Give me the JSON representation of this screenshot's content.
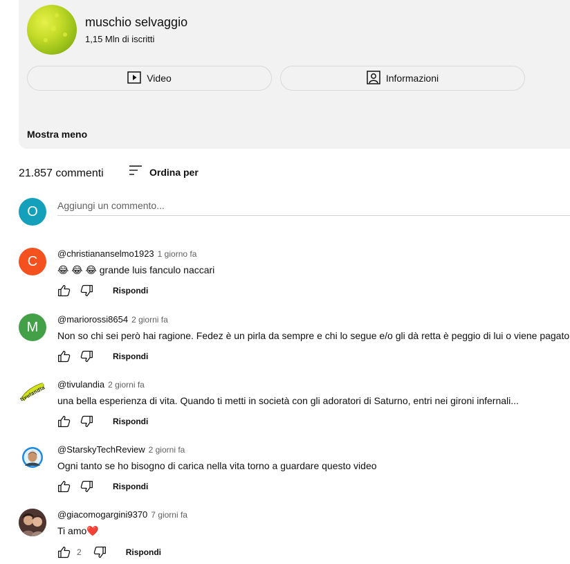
{
  "channel": {
    "name": "muschio selvaggio",
    "subscribers": "1,15 Mln di iscritti",
    "video_label": "Video",
    "info_label": "Informazioni",
    "show_less": "Mostra meno"
  },
  "comments_header": {
    "count": "21.857 commenti",
    "sort_label": "Ordina per"
  },
  "add_comment": {
    "avatar_letter": "O",
    "avatar_color": "#14a0ba",
    "placeholder": "Aggiungi un commento..."
  },
  "reply_label": "Rispondi",
  "comments": [
    {
      "author": "@christiananselmo1923",
      "time": "1 giorno fa",
      "text": "😂 😂 😂 grande luis fanculo naccari",
      "avatar_letter": "C",
      "avatar_color": "#f4511e",
      "likes": ""
    },
    {
      "author": "@mariorossi8654",
      "time": "2 giorni fa",
      "text": "Non so chi sei però hai ragione. Fedez è un pirla da sempre e chi lo segue e/o gli dà retta è peggio di lui o viene pagato.",
      "avatar_letter": "M",
      "avatar_color": "#43a047",
      "likes": ""
    },
    {
      "author": "@tivulandia",
      "time": "2 giorni fa",
      "text": "una bella esperienza di vita. Quando ti metti in società con gli adoratori di Saturno, entri nei gironi infernali...",
      "avatar_letter": "",
      "avatar_color": "#ffffff",
      "likes": ""
    },
    {
      "author": "@StarskyTechReview",
      "time": "2 giorni fa",
      "text": "Ogni tanto se ho bisogno di carica nella vita torno a guardare questo video",
      "avatar_letter": "",
      "avatar_color": "#1976d2",
      "likes": ""
    },
    {
      "author": "@giacomogargini9370",
      "time": "7 giorni fa",
      "text": "Ti amo❤️",
      "avatar_letter": "",
      "avatar_color": "#5d4037",
      "likes": "2"
    }
  ]
}
